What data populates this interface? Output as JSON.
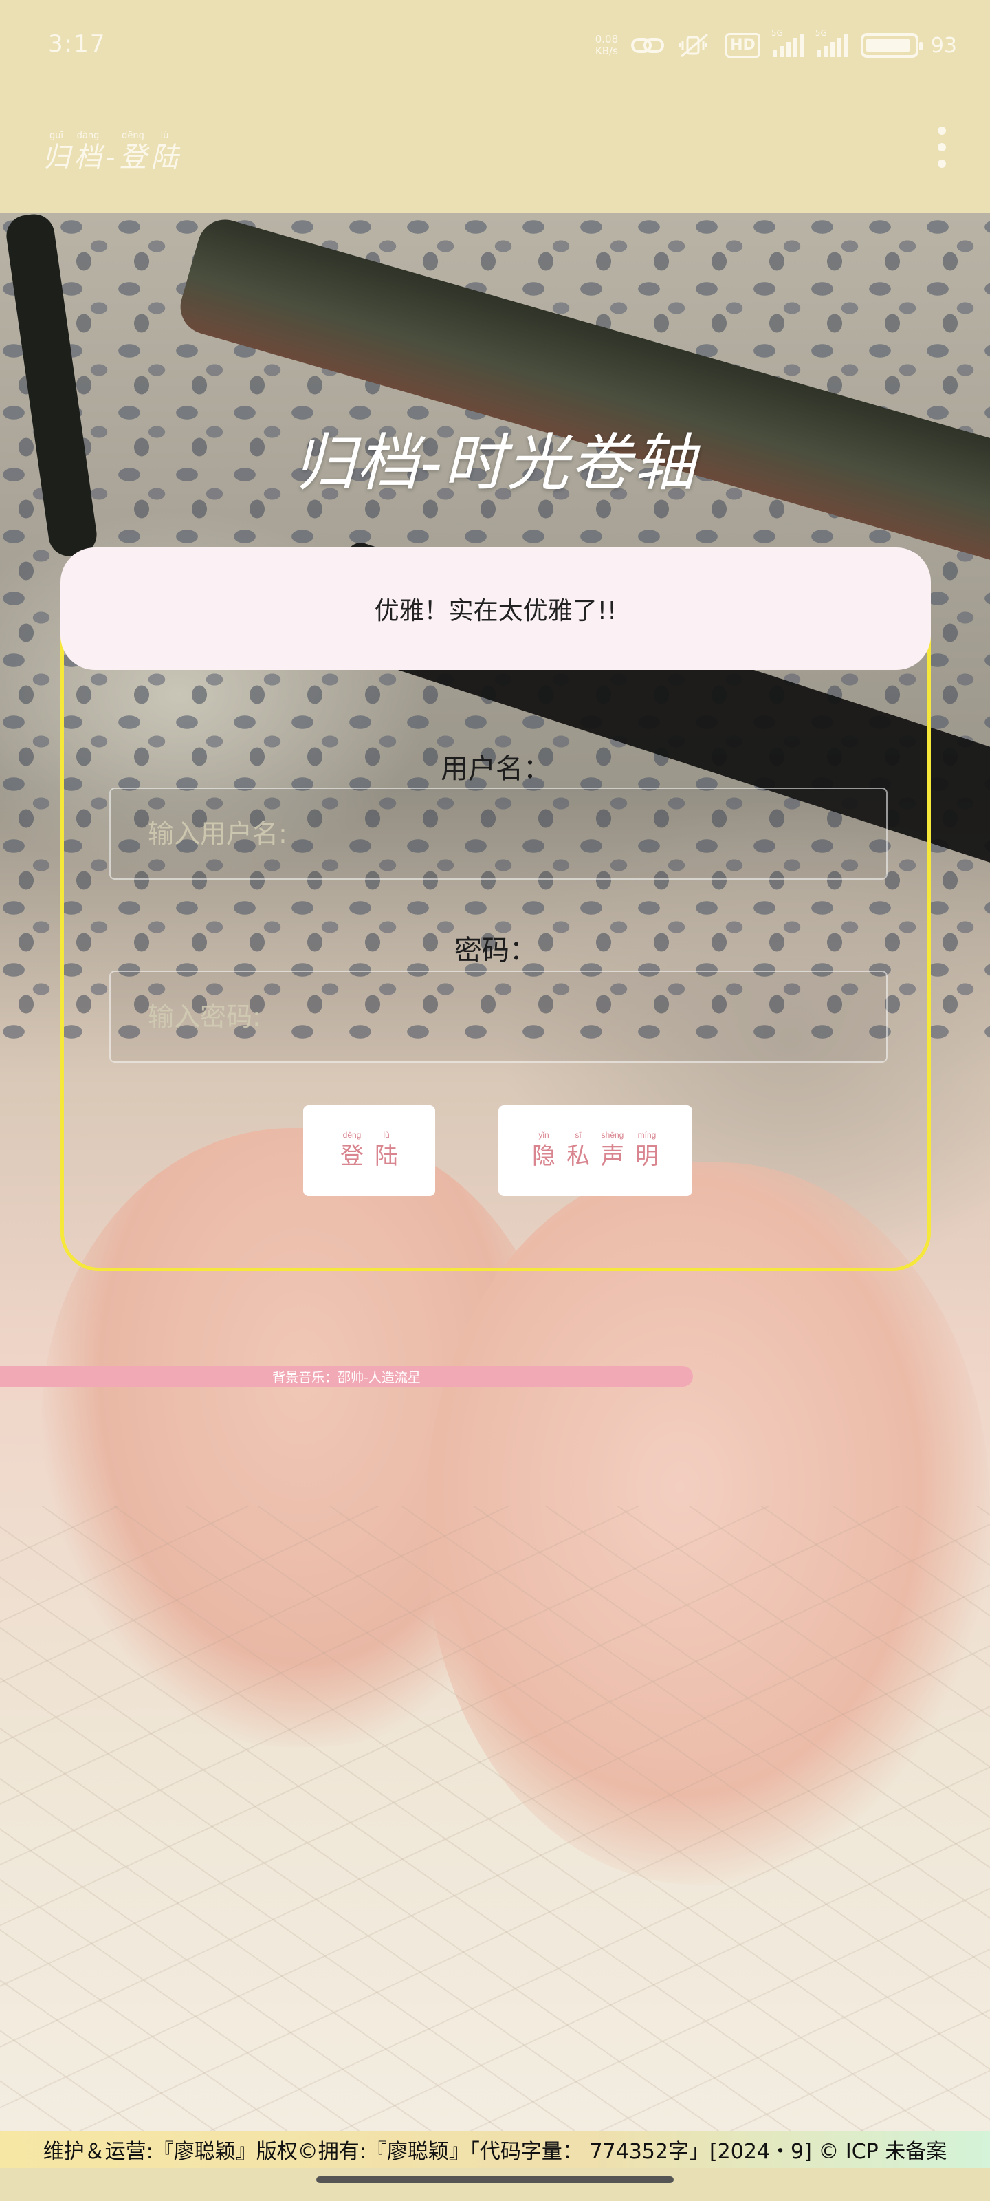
{
  "status_bar": {
    "time": "3:17",
    "net_speed_value": "0.08",
    "net_speed_unit": "KB/s",
    "hd_badge": "HD",
    "sim1_label": "5G",
    "sim2_label": "5G",
    "battery_percent": "93",
    "battery_level": 0.93
  },
  "app_header": {
    "title_chars": [
      {
        "pinyin": "guī",
        "hanzi": "归"
      },
      {
        "pinyin": "dàng",
        "hanzi": "档"
      },
      {
        "pinyin": "",
        "hanzi": "-"
      },
      {
        "pinyin": "dēng",
        "hanzi": "登"
      },
      {
        "pinyin": "lù",
        "hanzi": "陆"
      }
    ],
    "menu_icon": "more-vertical-icon"
  },
  "page": {
    "title": "归档-时光卷轴"
  },
  "login": {
    "banner_text": "优雅！实在太优雅了!!",
    "username_label": "用户名：",
    "username_placeholder": "输入用户名:",
    "password_label": "密码：",
    "password_placeholder": "输入密码:",
    "login_button": [
      {
        "pinyin": "dēng",
        "hanzi": "登"
      },
      {
        "pinyin": "lù",
        "hanzi": "陆"
      }
    ],
    "privacy_button": [
      {
        "pinyin": "yǐn",
        "hanzi": "隐"
      },
      {
        "pinyin": "sī",
        "hanzi": "私"
      },
      {
        "pinyin": "shēng",
        "hanzi": "声"
      },
      {
        "pinyin": "míng",
        "hanzi": "明"
      }
    ]
  },
  "music": {
    "text": "背景音乐：邵帅-人造流星"
  },
  "footer": {
    "text": "维护＆运营:『廖聪颖』版权©拥有:『廖聪颖』「代码字量： 774352字」[2024・9] © ICP 未备案"
  },
  "colors": {
    "header_bg": "#ebe0b4",
    "card_border": "#f6e83a",
    "banner_bg": "#fbf0f3",
    "button_text": "#d9858f",
    "music_bar": "#f2a9b6"
  }
}
